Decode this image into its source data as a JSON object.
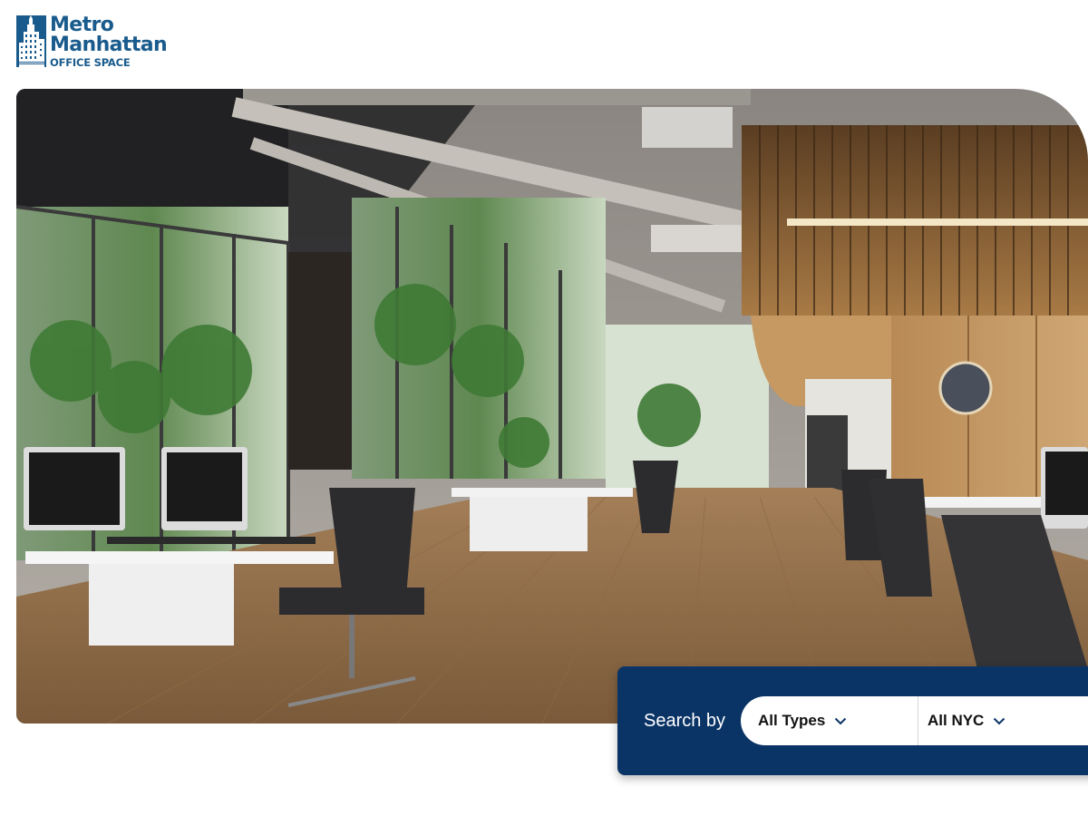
{
  "logo": {
    "line1": "Metro",
    "line2": "Manhattan",
    "line3": "OFFICE SPACE",
    "color": "#1a5b8d",
    "icon": "skyscraper-icon"
  },
  "hero": {
    "image": "modern open-plan office interior"
  },
  "search": {
    "label": "Search by",
    "type_select": {
      "value": "All Types",
      "icon": "chevron-down-icon"
    },
    "area_select": {
      "value": "All NYC",
      "icon": "chevron-down-icon"
    },
    "bar_color": "#0b3466"
  }
}
